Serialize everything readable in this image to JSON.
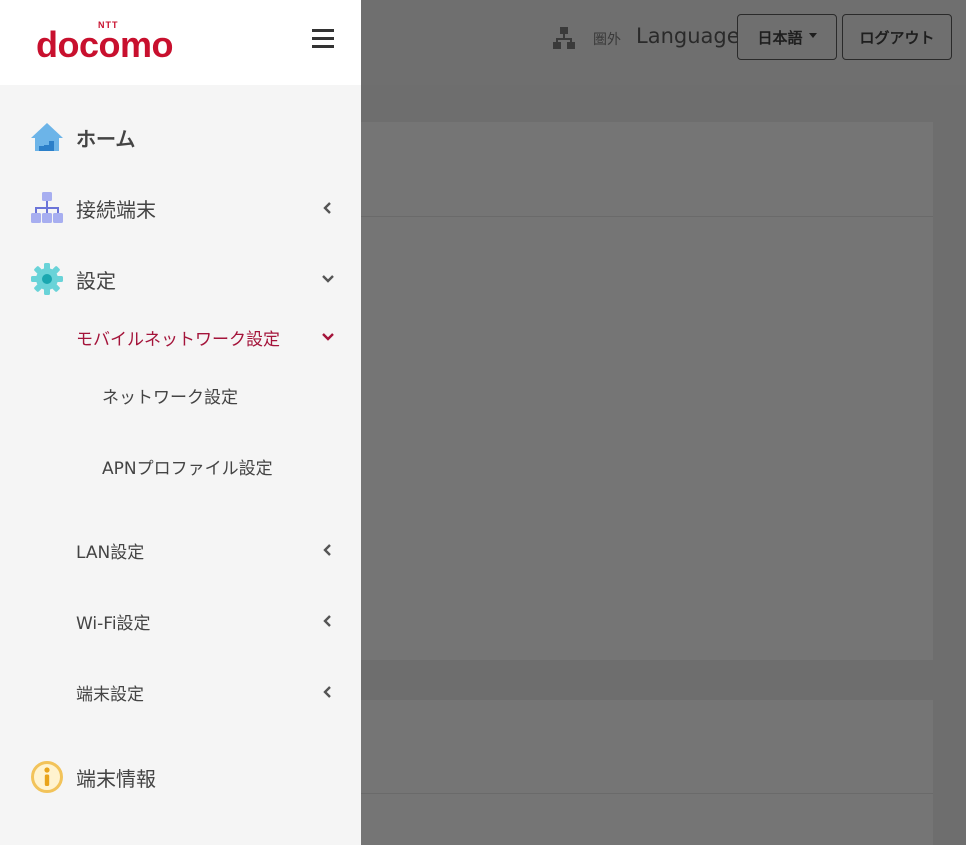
{
  "header": {
    "logo_brand": "NTT",
    "logo_text": "docomo",
    "signal_text": "圏外",
    "language_label": "Language",
    "language_select": "日本語",
    "logout_button": "ログアウト"
  },
  "sidebar": {
    "items": [
      {
        "label": "ホーム",
        "icon": "home-icon"
      },
      {
        "label": "接続端末",
        "icon": "network-icon",
        "chevron": "left"
      },
      {
        "label": "設定",
        "icon": "gear-icon",
        "chevron": "down"
      },
      {
        "label": "モバイルネットワーク設定",
        "chevron": "down",
        "active": true
      },
      {
        "label": "ネットワーク設定"
      },
      {
        "label": "APNプロファイル設定"
      },
      {
        "label": "LAN設定",
        "chevron": "left"
      },
      {
        "label": "Wi-Fi設定",
        "chevron": "left"
      },
      {
        "label": "端末設定",
        "chevron": "left"
      },
      {
        "label": "端末情報",
        "icon": "info-icon"
      }
    ]
  },
  "colors": {
    "brand": "#c8102e",
    "active": "#a4143a",
    "overlay": "#6e6e6e"
  }
}
